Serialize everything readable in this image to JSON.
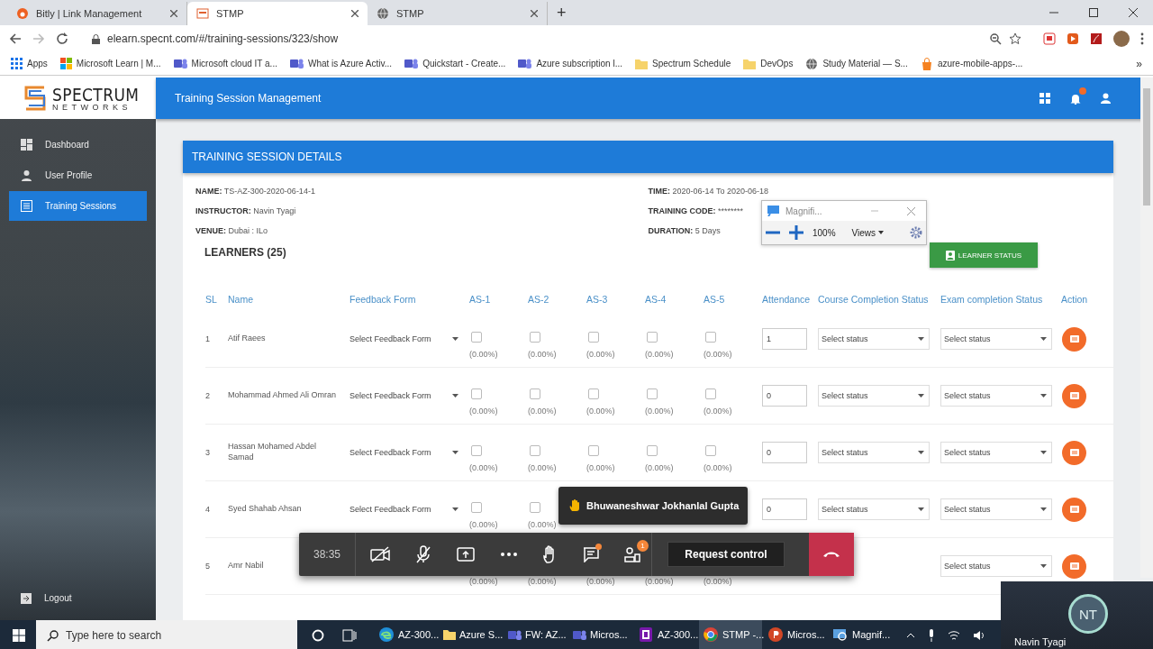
{
  "browser": {
    "tabs": [
      {
        "title": "Bitly | Link Management",
        "kind": "bitly",
        "selected": false
      },
      {
        "title": "STMP",
        "kind": "app",
        "selected": true
      },
      {
        "title": "STMP",
        "kind": "globe",
        "selected": false
      }
    ],
    "new_tab": "+",
    "url": "elearn.specnt.com/#/training-sessions/323/show",
    "bookmarks": [
      {
        "label": "Apps",
        "kind": "apps"
      },
      {
        "label": "Microsoft Learn | M...",
        "kind": "ms"
      },
      {
        "label": "Microsoft cloud IT a...",
        "kind": "teams"
      },
      {
        "label": "What is Azure Activ...",
        "kind": "teams"
      },
      {
        "label": "Quickstart - Create...",
        "kind": "teams"
      },
      {
        "label": "Azure subscription l...",
        "kind": "teams"
      },
      {
        "label": "Spectrum Schedule",
        "kind": "folder"
      },
      {
        "label": "DevOps",
        "kind": "folder"
      },
      {
        "label": "Study Material — S...",
        "kind": "globe"
      },
      {
        "label": "azure-mobile-apps-...",
        "kind": "bag"
      }
    ],
    "bookmarks_more": "»"
  },
  "app": {
    "logo": {
      "title": "SPECTRUM",
      "subtitle": "NETWORKS"
    },
    "header_title": "Training Session Management",
    "sidebar": {
      "items": [
        {
          "label": "Dashboard",
          "kind": "dashboard",
          "selected": false
        },
        {
          "label": "User Profile",
          "kind": "user",
          "selected": false
        },
        {
          "label": "Training Sessions",
          "kind": "list",
          "selected": true
        }
      ],
      "logout": "Logout"
    },
    "card": {
      "title": "TRAINING SESSION DETAILS",
      "details_left": [
        {
          "label": "NAME:",
          "value": "TS-AZ-300-2020-06-14-1"
        },
        {
          "label": "INSTRUCTOR:",
          "value": "Navin Tyagi"
        },
        {
          "label": "VENUE:",
          "value": "Dubai : ILo"
        }
      ],
      "details_right": [
        {
          "label": "TIME:",
          "value": "2020-06-14 To 2020-06-18"
        },
        {
          "label": "TRAINING CODE:",
          "value": "********"
        },
        {
          "label": "DURATION:",
          "value": "5 Days"
        }
      ],
      "learners_title": "LEARNERS (25)",
      "learner_status_button": "LEARNER STATUS",
      "table": {
        "columns": [
          "SL",
          "Name",
          "Feedback Form",
          "AS-1",
          "AS-2",
          "AS-3",
          "AS-4",
          "AS-5",
          "Attendance",
          "Course Completion Status",
          "Exam completion Status",
          "Action"
        ],
        "rows": [
          {
            "sl": "1",
            "name": "Atif Raees",
            "feedback": "Select Feedback Form",
            "assessments": [
              {
                "checked": false,
                "percent": "(0.00%)"
              },
              {
                "checked": false,
                "percent": "(0.00%)"
              },
              {
                "checked": false,
                "percent": "(0.00%)"
              },
              {
                "checked": false,
                "percent": "(0.00%)"
              },
              {
                "checked": false,
                "percent": "(0.00%)"
              }
            ],
            "attendance": "1",
            "course_status": "Select status",
            "exam_status": "Select status"
          },
          {
            "sl": "2",
            "name": "Mohammad Ahmed Ali Omran",
            "feedback": "Select Feedback Form",
            "assessments": [
              {
                "checked": false,
                "percent": "(0.00%)"
              },
              {
                "checked": false,
                "percent": "(0.00%)"
              },
              {
                "checked": false,
                "percent": "(0.00%)"
              },
              {
                "checked": false,
                "percent": "(0.00%)"
              },
              {
                "checked": false,
                "percent": "(0.00%)"
              }
            ],
            "attendance": "0",
            "course_status": "Select status",
            "exam_status": "Select status"
          },
          {
            "sl": "3",
            "name": "Hassan Mohamed Abdel Samad",
            "feedback": "Select Feedback Form",
            "assessments": [
              {
                "checked": false,
                "percent": "(0.00%)"
              },
              {
                "checked": false,
                "percent": "(0.00%)"
              },
              {
                "checked": false,
                "percent": "(0.00%)"
              },
              {
                "checked": false,
                "percent": "(0.00%)"
              },
              {
                "checked": false,
                "percent": "(0.00%)"
              }
            ],
            "attendance": "0",
            "course_status": "Select status",
            "exam_status": "Select status"
          },
          {
            "sl": "4",
            "name": "Syed Shahab Ahsan",
            "feedback": "Select Feedback Form",
            "assessments": [
              {
                "checked": false,
                "percent": "(0.00%)"
              },
              {
                "checked": false,
                "percent": "(0.00%)"
              }
            ],
            "attendance": "0",
            "course_status": "Select status",
            "exam_status": "Select status"
          },
          {
            "sl": "5",
            "name": "Amr Nabil",
            "feedback": null,
            "assessments": [
              {
                "percent": "(0.00%)"
              },
              {
                "percent": "(0.00%)"
              },
              {
                "percent": "(0.00%)"
              },
              {
                "percent": "(0.00%)"
              },
              {
                "percent": "(0.00%)"
              }
            ],
            "attendance": null,
            "course_status": null,
            "exam_status": "Select status"
          }
        ]
      }
    }
  },
  "magnifier": {
    "title": "Magnifi...",
    "zoom": "100%",
    "views": "Views"
  },
  "meeting": {
    "timer": "38:35",
    "chat_unread": true,
    "participants_badge": "1",
    "request_control": "Request control",
    "raised_hand": "Bhuwaneshwar Jokhanlal Gupta"
  },
  "video_tile": {
    "initials": "NT",
    "name": "Navin Tyagi"
  },
  "taskbar": {
    "search_placeholder": "Type here to search",
    "apps": [
      {
        "label": "AZ-300...",
        "kind": "edge",
        "selected": false
      },
      {
        "label": "Azure S...",
        "kind": "folder",
        "selected": false
      },
      {
        "label": "FW: AZ...",
        "kind": "teams",
        "selected": false
      },
      {
        "label": "Micros...",
        "kind": "teams",
        "selected": false
      },
      {
        "label": "AZ-300...",
        "kind": "onenote",
        "selected": false
      },
      {
        "label": "STMP -...",
        "kind": "chrome",
        "selected": true
      },
      {
        "label": "Micros...",
        "kind": "powerpoint",
        "selected": false
      },
      {
        "label": "Magnif...",
        "kind": "magnifier",
        "selected": false
      }
    ]
  }
}
